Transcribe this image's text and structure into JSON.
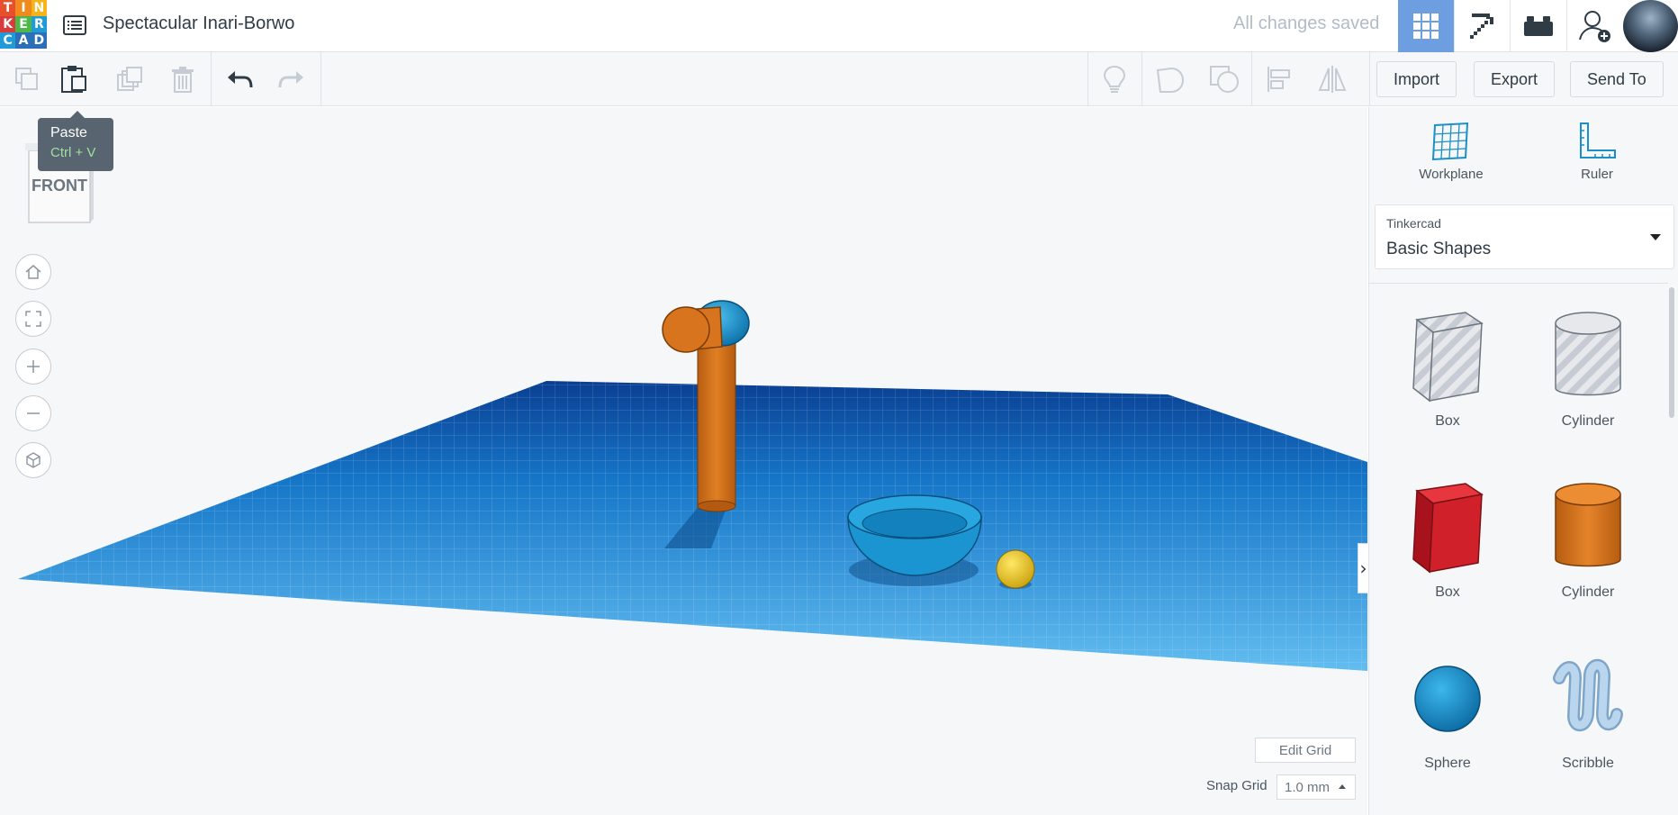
{
  "logo": {
    "letters": [
      "T",
      "I",
      "N",
      "K",
      "E",
      "R",
      "C",
      "A",
      "D"
    ]
  },
  "header": {
    "title": "Spectacular Inari-Borwo",
    "save_status": "All changes saved"
  },
  "icons": {
    "menu": "list-icon",
    "view_3d": "grid-icon",
    "view_codeblocks": "pickaxe-icon",
    "view_bricks": "brick-icon",
    "invite": "add-user-icon"
  },
  "toolbar": {
    "import_label": "Import",
    "export_label": "Export",
    "send_to_label": "Send To"
  },
  "tooltip": {
    "title": "Paste",
    "shortcut": "Ctrl + V"
  },
  "viewcube": {
    "face_label": "FRONT"
  },
  "viewport": {
    "edit_grid_label": "Edit Grid",
    "snap_grid_label": "Snap Grid",
    "snap_grid_value": "1.0 mm"
  },
  "panel": {
    "workplane_label": "Workplane",
    "ruler_label": "Ruler",
    "library_provider": "Tinkercad",
    "library_name": "Basic Shapes",
    "shapes": [
      {
        "label": "Box",
        "icon": "box-hole-icon"
      },
      {
        "label": "Cylinder",
        "icon": "cylinder-hole-icon"
      },
      {
        "label": "Box",
        "icon": "box-solid-icon"
      },
      {
        "label": "Cylinder",
        "icon": "cylinder-solid-icon"
      },
      {
        "label": "Sphere",
        "icon": "sphere-icon"
      },
      {
        "label": "Scribble",
        "icon": "scribble-icon"
      }
    ]
  },
  "colors": {
    "accent": "#6d9ee0",
    "workplane_blue": "#1b8fd6",
    "shape_orange": "#d8741e",
    "shape_blue": "#1b95d2",
    "shape_red": "#d0202a",
    "shape_yellow": "#f2cc1f"
  }
}
